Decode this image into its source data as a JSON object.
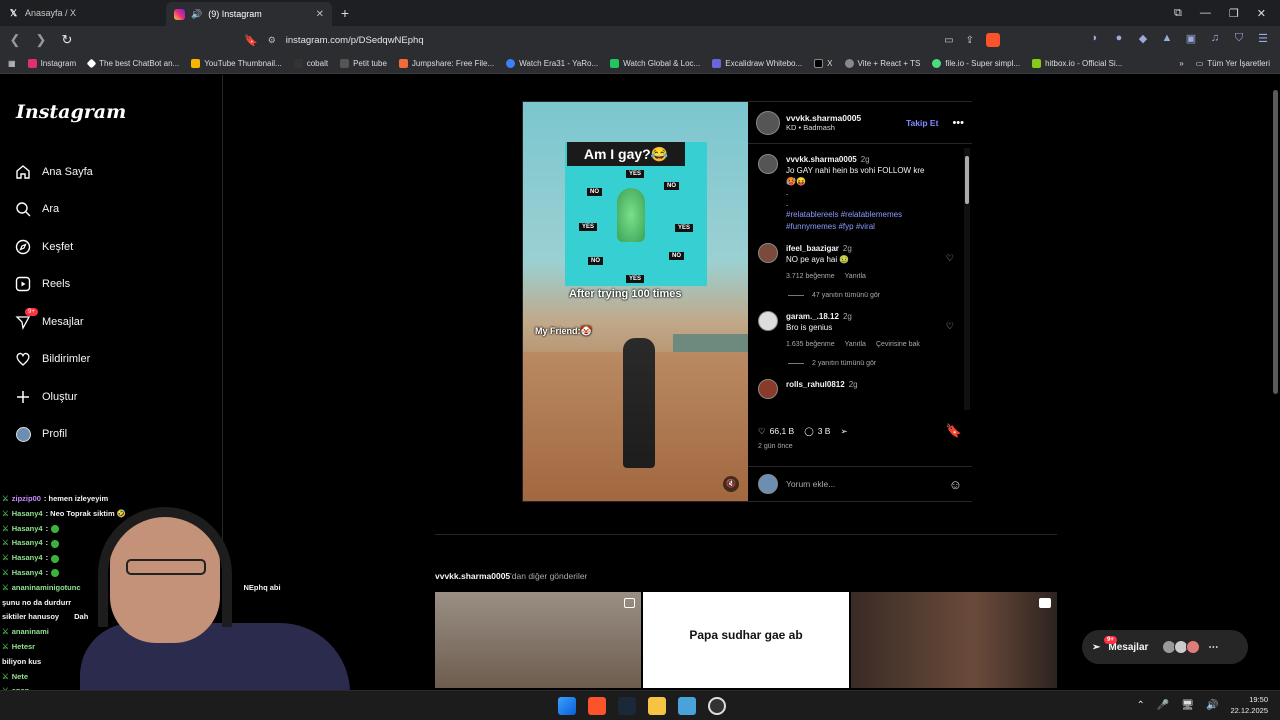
{
  "browser": {
    "tabs": [
      {
        "title": "Anasayfa / X",
        "active": false
      },
      {
        "title": "(9) Instagram",
        "active": true
      }
    ],
    "url": "instagram.com/p/DSedqwNEphq",
    "bookmarks": [
      "Instagram",
      "The best ChatBot an...",
      "YouTube Thumbnail...",
      "cobalt",
      "Petit tube",
      "Jumpshare: Free File...",
      "Watch Era31 - YaRo...",
      "Watch Global & Loc...",
      "Excalidraw Whitebo...",
      "X",
      "Vite + React + TS",
      "file.io - Super simpl...",
      "hitbox.io - Official Si..."
    ],
    "all_bookmarks": "Tüm Yer İşaretleri"
  },
  "instagram": {
    "logo": "Instagram",
    "nav": [
      {
        "label": "Ana Sayfa",
        "icon": "home-icon"
      },
      {
        "label": "Ara",
        "icon": "search-icon"
      },
      {
        "label": "Keşfet",
        "icon": "compass-icon"
      },
      {
        "label": "Reels",
        "icon": "reels-icon"
      },
      {
        "label": "Mesajlar",
        "icon": "messenger-icon",
        "badge": "9+"
      },
      {
        "label": "Bildirimler",
        "icon": "heart-icon"
      },
      {
        "label": "Oluştur",
        "icon": "plus-icon"
      },
      {
        "label": "Profil",
        "icon": "avatar-icon"
      }
    ],
    "post": {
      "media": {
        "title": "Am I gay?😂",
        "chips": [
          "YES",
          "NO",
          "NO",
          "YES",
          "YES",
          "NO",
          "NO",
          "YES"
        ],
        "caption1": "After trying 100 times",
        "caption2": "My Friend:🤡"
      },
      "username": "vvvkk.sharma0005",
      "subtitle": "KD • Badmash",
      "follow": "Takip Et",
      "caption": {
        "user": "vvvkk.sharma0005",
        "time": "2g",
        "text": "Jo GAY nahi hein bs vohi FOLLOW kre",
        "emoji": "🥵😝",
        "dots": [
          ".",
          "."
        ],
        "tags": "#relatablereels #relatablememes #funnymemes #fyp #viral"
      },
      "comments": [
        {
          "user": "ifeel_baazigar",
          "time": "2g",
          "text": "NO pe aya hai 🤢",
          "likes": "3.712 beğenme",
          "reply": "Yanıtla",
          "translate": "",
          "replies": "47 yanıtın tümünü gör"
        },
        {
          "user": "garam._.18.12",
          "time": "2g",
          "text": "Bro is genius",
          "likes": "1.635 beğenme",
          "reply": "Yanıtla",
          "translate": "Çevirisine bak",
          "replies": "2 yanıtın tümünü gör"
        },
        {
          "user": "rolls_rahul0812",
          "time": "2g",
          "text": "",
          "likes": "",
          "reply": "",
          "translate": "",
          "replies": ""
        }
      ],
      "likes": "66,1 B",
      "comment_count": "3 B",
      "ago": "2 gün önce",
      "add_comment_placeholder": "Yorum ekle..."
    },
    "more": {
      "user": "vvvkk.sharma0005",
      "suffix": "'dan diğer gönderiler",
      "cells": [
        "",
        "Papa sudhar gae ab",
        ""
      ]
    },
    "messages_button": {
      "label": "Mesajlar",
      "badge": "9+"
    }
  },
  "stream_chat": [
    {
      "user": "zipzip00",
      "msg": ": hemen izleyeyim"
    },
    {
      "user": "Hasany4",
      "msg": ": Neo Toprak siktim 🤣"
    },
    {
      "user": "Hasany4",
      "msg": ":"
    },
    {
      "user": "Hasany4",
      "msg": ":"
    },
    {
      "user": "Hasany4",
      "msg": ":"
    },
    {
      "user": "Hasany4",
      "msg": ":"
    },
    {
      "user": "ananinaminigotunc",
      "msg": ""
    },
    {
      "user": "",
      "msg": "şunu no da durdurr"
    },
    {
      "user": "",
      "msg": "siktiler hanusoy"
    },
    {
      "user": "ananinami",
      "msg": ""
    },
    {
      "user": "Hetesr",
      "msg": ""
    },
    {
      "user": "",
      "msg": "biliyon kus"
    },
    {
      "user": "Nete",
      "msg": ""
    },
    {
      "user": "anan",
      "msg": ""
    }
  ],
  "chat_extra": "NEphq abi",
  "chat_extra2": "Dah",
  "clock": {
    "time": "19:50",
    "date": "22.12.2025"
  }
}
